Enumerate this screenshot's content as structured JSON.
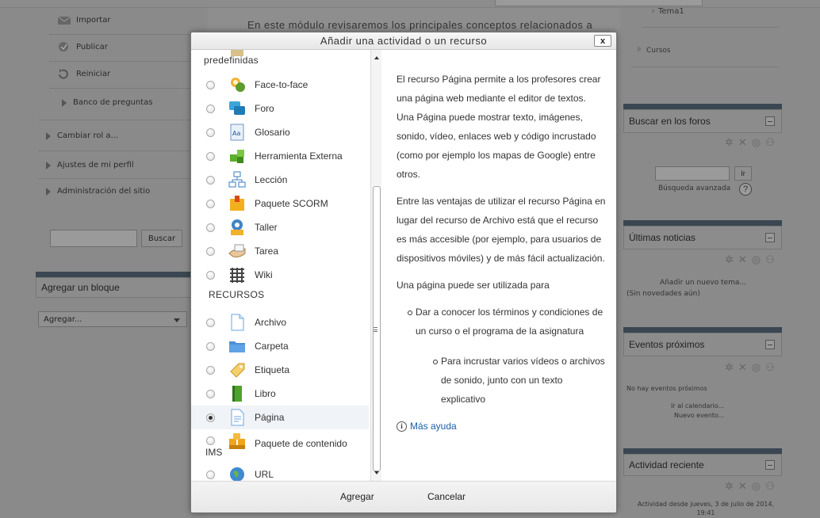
{
  "background": {
    "nav": {
      "importar": "Importar",
      "publicar": "Publicar",
      "reiniciar": "Reiniciar",
      "banco": "Banco de preguntas",
      "cambiar_rol": "Cambiar rol a...",
      "ajustes_perfil": "Ajustes de mi perfil",
      "administracion": "Administración del sitio"
    },
    "search_button": "Buscar",
    "agregar_bloque": "Agregar un bloque",
    "agregar_select": "Agregar...",
    "center_intro": "En este módulo revisaremos los principales conceptos relacionados a",
    "right": {
      "tema": "Tema1",
      "cursos": "Cursos",
      "buscar_foros": "Buscar en los foros",
      "go_button": "Ir",
      "busqueda_avanzada": "Búsqueda avanzada",
      "ultimas_noticias": "Últimas noticias",
      "anadir_tema": "Añadir un nuevo tema...",
      "sin_novedades": "(Sin novedades aún)",
      "eventos_proximos": "Eventos próximos",
      "no_eventos": "No hay eventos próximos",
      "ir_calendario": "Ir al calendario...",
      "nuevo_evento": "Nuevo evento...",
      "actividad_reciente": "Actividad desde jueves, 3 de julio de 2014,",
      "actividad_reciente_line2": "19:41",
      "actividad_reciente_title": "Actividad reciente"
    }
  },
  "modal": {
    "title": "Añadir una actividad o un recurso",
    "close_label": "x",
    "partial_section": "predefinidas",
    "activities": [
      {
        "label": "Face-to-face",
        "icon": "face-to-face-icon"
      },
      {
        "label": "Foro",
        "icon": "forum-icon"
      },
      {
        "label": "Glosario",
        "icon": "glossary-icon"
      },
      {
        "label": "Herramienta Externa",
        "icon": "external-tool-icon"
      },
      {
        "label": "Lección",
        "icon": "lesson-icon"
      },
      {
        "label": "Paquete SCORM",
        "icon": "scorm-icon"
      },
      {
        "label": "Taller",
        "icon": "workshop-icon"
      },
      {
        "label": "Tarea",
        "icon": "assignment-icon"
      },
      {
        "label": "Wiki",
        "icon": "wiki-icon"
      }
    ],
    "resources_heading": "RECURSOS",
    "resources": [
      {
        "label": "Archivo",
        "icon": "file-icon",
        "selected": false
      },
      {
        "label": "Carpeta",
        "icon": "folder-icon",
        "selected": false
      },
      {
        "label": "Etiqueta",
        "icon": "label-icon",
        "selected": false
      },
      {
        "label": "Libro",
        "icon": "book-icon",
        "selected": false
      },
      {
        "label": "Página",
        "icon": "page-icon",
        "selected": true
      },
      {
        "label": "Paquete de contenido",
        "label2": "IMS",
        "icon": "ims-package-icon",
        "selected": false
      },
      {
        "label": "URL",
        "icon": "url-icon",
        "selected": false
      }
    ],
    "description": {
      "p1": "El recurso Página permite a los profesores crear una página web mediante el editor de textos. Una Página puede mostrar texto, imágenes, sonido, vídeo, enlaces web y código incrustado (como por ejemplo los mapas de Google) entre otros.",
      "p2": "Entre las ventajas de utilizar el recurso Página en lugar del recurso de Archivo está que el recurso es más accesible (por ejemplo, para usuarios de dispositivos móviles) y de más fácil actualización.",
      "p3": "Una página puede ser utilizada para",
      "bullet1": "Dar a conocer los términos y condiciones de un curso o el programa de la asignatura",
      "bullet2": "Para incrustar varios vídeos o archivos de sonido, junto con un texto explicativo",
      "more_help": "Más ayuda"
    },
    "footer": {
      "add": "Agregar",
      "cancel": "Cancelar"
    }
  }
}
